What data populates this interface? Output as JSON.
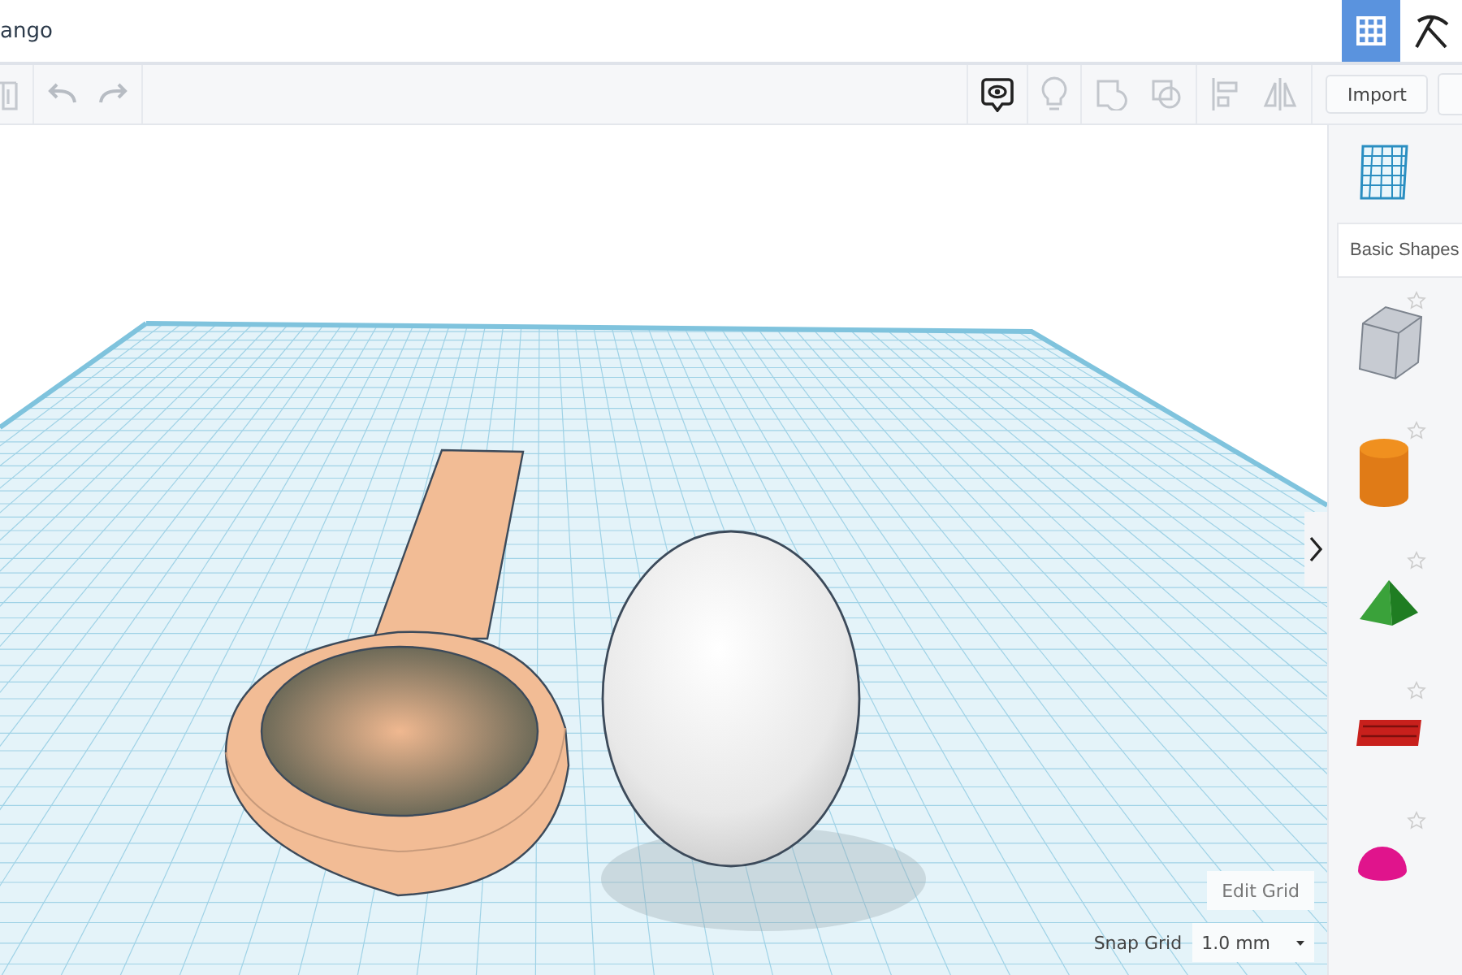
{
  "top_bar": {
    "title": "ango",
    "view_buttons": [
      {
        "kind": "grid",
        "selected": true
      },
      {
        "kind": "tools",
        "selected": false
      }
    ]
  },
  "toolbar": {
    "import_button": "Import"
  },
  "canvas": {
    "edit_grid_button": "Edit Grid",
    "snap_grid": {
      "label": "Snap Grid",
      "value": "1.0 mm"
    }
  },
  "shapes_panel": {
    "category": "Basic Shapes",
    "shapes": [
      {
        "kind": "box"
      },
      {
        "kind": "cylinder"
      },
      {
        "kind": "roof"
      },
      {
        "kind": "text"
      },
      {
        "kind": "half-sphere"
      }
    ]
  }
}
